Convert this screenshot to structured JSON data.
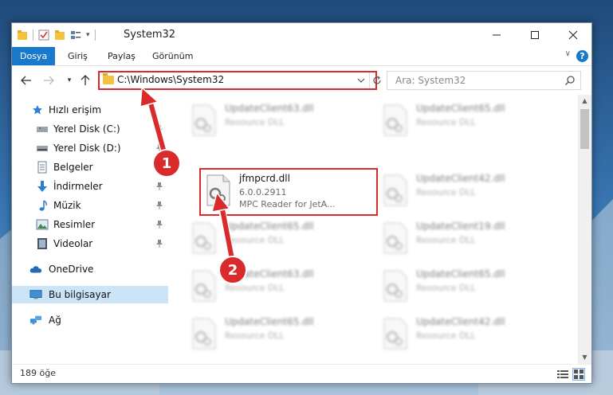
{
  "window": {
    "title": "System32"
  },
  "ribbon": {
    "tabs": [
      {
        "label": "Dosya",
        "active": true
      },
      {
        "label": "Giriş",
        "active": false
      },
      {
        "label": "Paylaş",
        "active": false
      },
      {
        "label": "Görünüm",
        "active": false
      }
    ],
    "help_glyph": "?"
  },
  "address": {
    "path": "C:\\Windows\\System32",
    "search_placeholder": "Ara: System32"
  },
  "nav": {
    "items": [
      {
        "label": "Hızlı erişim",
        "icon": "star-icon",
        "pinned": false,
        "selected": false
      },
      {
        "label": "Yerel Disk (C:)",
        "icon": "drive-c-icon",
        "pinned": true,
        "selected": false
      },
      {
        "label": "Yerel Disk (D:)",
        "icon": "drive-d-icon",
        "pinned": true,
        "selected": false
      },
      {
        "label": "Belgeler",
        "icon": "documents-icon",
        "pinned": true,
        "selected": false
      },
      {
        "label": "İndirmeler",
        "icon": "downloads-icon",
        "pinned": true,
        "selected": false
      },
      {
        "label": "Müzik",
        "icon": "music-icon",
        "pinned": true,
        "selected": false
      },
      {
        "label": "Resimler",
        "icon": "pictures-icon",
        "pinned": true,
        "selected": false
      },
      {
        "label": "Videolar",
        "icon": "videos-icon",
        "pinned": true,
        "selected": false
      },
      {
        "label": "OneDrive",
        "icon": "cloud-icon",
        "pinned": false,
        "selected": false
      },
      {
        "label": "Bu bilgisayar",
        "icon": "computer-icon",
        "pinned": false,
        "selected": true
      },
      {
        "label": "Ağ",
        "icon": "network-icon",
        "pinned": false,
        "selected": false
      }
    ]
  },
  "files": {
    "focused": {
      "name": "jfmpcrd.dll",
      "version": "6.0.0.2911",
      "description": "MPC Reader for JetA..."
    },
    "blurred": [
      {
        "name": "UpdateClient63.dll",
        "type": "Resource DLL"
      },
      {
        "name": "UpdateClient65.dll",
        "type": "Resource DLL"
      },
      {
        "name": "UpdateClient42.dll",
        "type": "Resource DLL"
      },
      {
        "name": "UpdateClient65.dll",
        "type": "Resource DLL"
      },
      {
        "name": "UpdateClient19.dll",
        "type": "Resource DLL"
      },
      {
        "name": "UpdateClient63.dll",
        "type": "Resource DLL"
      },
      {
        "name": "UpdateClient65.dll",
        "type": "Resource DLL"
      },
      {
        "name": "UpdateClient65.dll",
        "type": "Resource DLL"
      },
      {
        "name": "UpdateClient42.dll",
        "type": "Resource DLL"
      }
    ]
  },
  "annotations": {
    "badge_1": "1",
    "badge_2": "2",
    "highlight_color": "#d92b2b"
  },
  "status": {
    "item_count": "189 öğe"
  },
  "colors": {
    "accent": "#1979ca",
    "selection": "#cce4f7"
  }
}
